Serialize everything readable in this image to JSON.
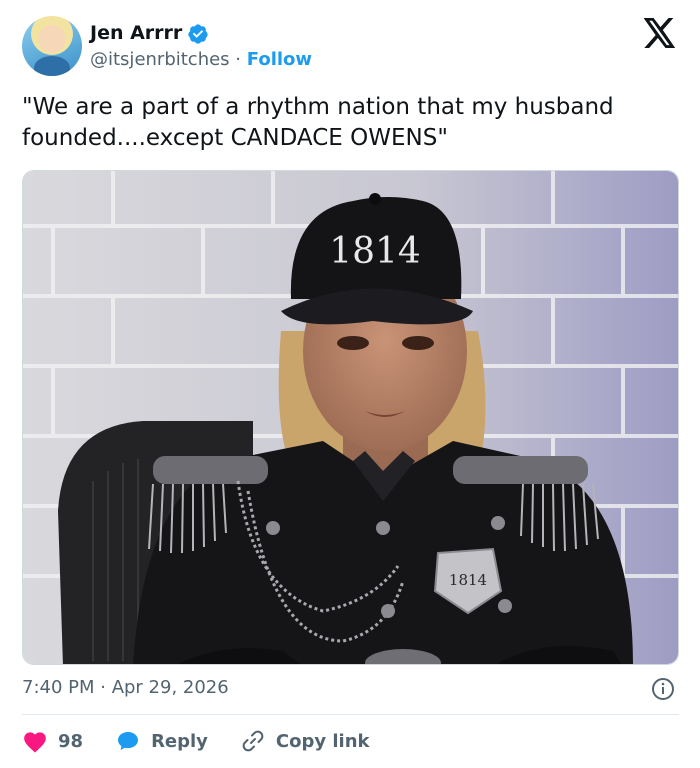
{
  "author": {
    "name": "Jen Arrrr",
    "handle": "@itsjenrbitches",
    "separator": "·",
    "follow_label": "Follow"
  },
  "tweet": {
    "text": "\"We are a part of a rhythm nation that my husband founded....except CANDACE OWENS\"",
    "timestamp": "7:40 PM · Apr 29, 2026"
  },
  "media": {
    "hat_text": "1814",
    "badge_text": "1814"
  },
  "actions": {
    "likes": "98",
    "reply_label": "Reply",
    "copy_link_label": "Copy link"
  },
  "colors": {
    "like": "#f91880",
    "reply": "#1d9bf0",
    "follow": "#1d9bf0",
    "verified": "#1d9bf0"
  }
}
